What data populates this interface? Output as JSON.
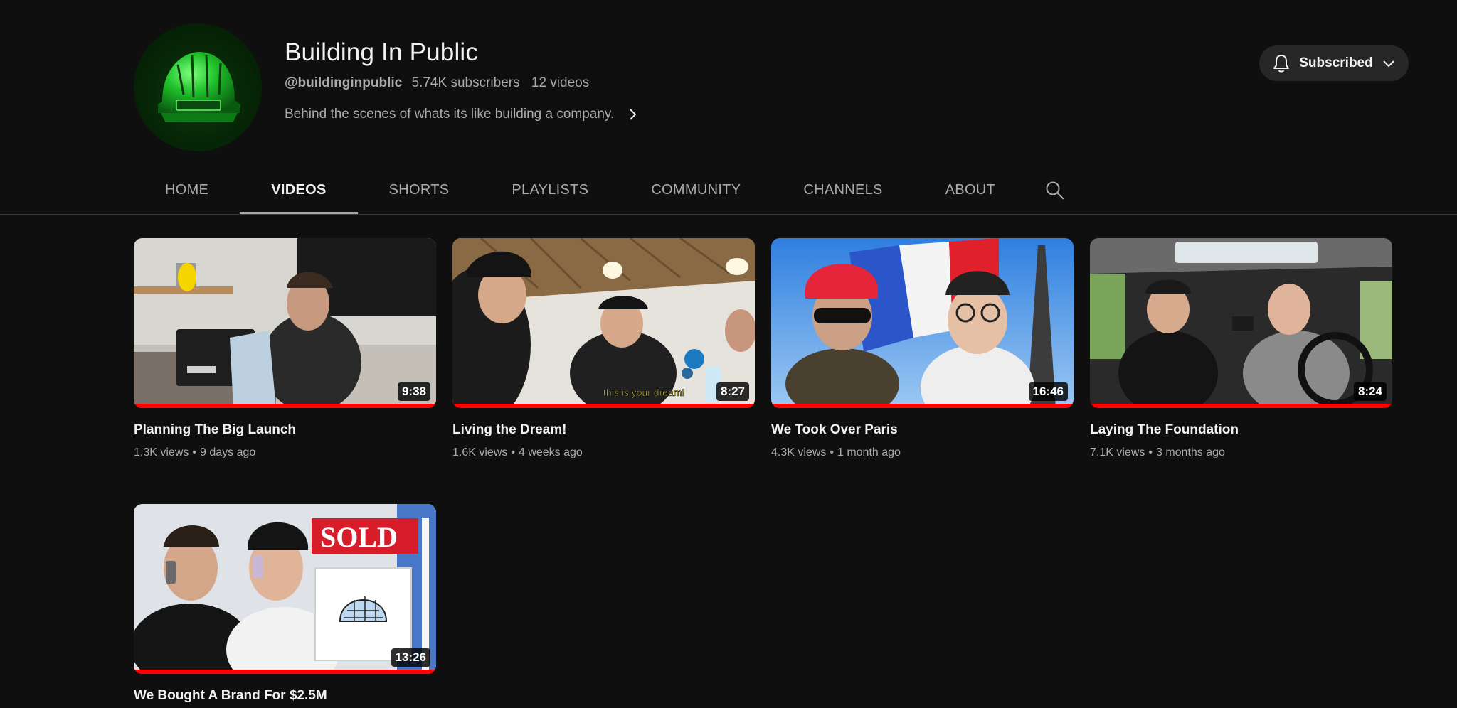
{
  "channel": {
    "name": "Building In Public",
    "handle": "@buildinginpublic",
    "subscribers": "5.74K subscribers",
    "videos_count": "12 videos",
    "description": "Behind the scenes of whats its like building a company.",
    "avatar_icon": "hard-hat-icon",
    "subscribe_label": "Subscribed"
  },
  "tabs": [
    {
      "label": "HOME",
      "active": false
    },
    {
      "label": "VIDEOS",
      "active": true
    },
    {
      "label": "SHORTS",
      "active": false
    },
    {
      "label": "PLAYLISTS",
      "active": false
    },
    {
      "label": "COMMUNITY",
      "active": false
    },
    {
      "label": "CHANNELS",
      "active": false
    },
    {
      "label": "ABOUT",
      "active": false
    }
  ],
  "colors": {
    "background": "#0f0f0f",
    "accent_progress": "#ff0000",
    "text_primary": "#f1f1f1",
    "text_secondary": "#aaaaaa"
  },
  "videos": [
    {
      "title": "Planning The Big Launch",
      "views": "1.3K views",
      "age": "9 days ago",
      "duration": "9:38",
      "watched": 1.0
    },
    {
      "title": "Living the Dream!",
      "views": "1.6K views",
      "age": "4 weeks ago",
      "duration": "8:27",
      "watched": 1.0,
      "caption": "this is your dream!"
    },
    {
      "title": "We Took Over Paris",
      "views": "4.3K views",
      "age": "1 month ago",
      "duration": "16:46",
      "watched": 1.0
    },
    {
      "title": "Laying The Foundation",
      "views": "7.1K views",
      "age": "3 months ago",
      "duration": "8:24",
      "watched": 1.0
    },
    {
      "title": "We Bought A Brand For $2.5M",
      "duration": "13:26",
      "watched": 1.0,
      "sign": "SOLD"
    }
  ]
}
